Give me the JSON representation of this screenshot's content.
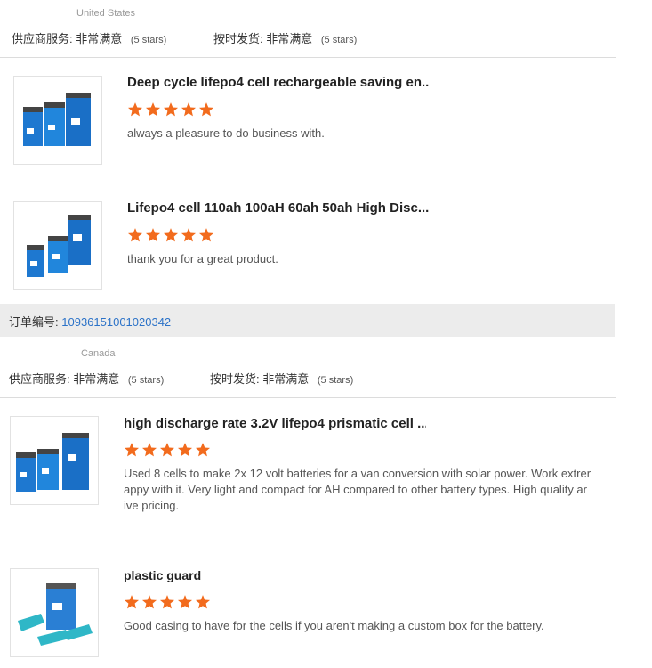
{
  "store1": {
    "country": "United States",
    "service_label": "供应商服务:",
    "service_value": "非常满意",
    "service_stars": "(5 stars)",
    "shipping_label": "按时发货:",
    "shipping_value": "非常满意",
    "shipping_stars": "(5 stars)",
    "items": [
      {
        "title": "Deep cycle lifepo4 cell rechargeable saving en...",
        "rating": 5,
        "review": "always a pleasure to do business with."
      },
      {
        "title": "Lifepo4 cell 110ah 100aH 60ah 50ah High Disc...",
        "rating": 5,
        "review": "thank you for a great product."
      }
    ]
  },
  "order": {
    "label": "订单编号:",
    "number": "10936151001020342"
  },
  "store2": {
    "country": "Canada",
    "service_label": "供应商服务:",
    "service_value": "非常满意",
    "service_stars": "(5 stars)",
    "shipping_label": "按时发货:",
    "shipping_value": "非常满意",
    "shipping_stars": "(5 stars)",
    "items": [
      {
        "title": "high discharge rate 3.2V lifepo4 prismatic cell ...",
        "rating": 5,
        "review_lines": [
          "Used 8 cells to make 2x 12 volt batteries for a van conversion with solar power. Work extrer",
          "appy with it. Very light and compact for AH compared to other battery types. High quality ar",
          "ive pricing."
        ]
      },
      {
        "title": "plastic guard",
        "rating": 5,
        "review": "Good casing to have for the cells if you aren't making a custom box for the battery."
      }
    ]
  },
  "colors": {
    "star": "#f26b1d",
    "link": "#2b72c8",
    "order_bar": "#ececec"
  }
}
